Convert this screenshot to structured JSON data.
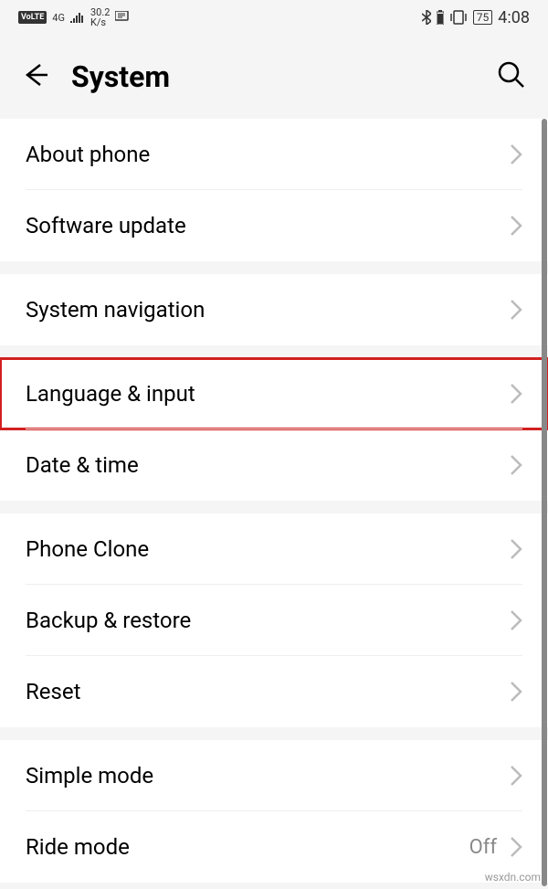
{
  "statusBar": {
    "volte": "VoLTE",
    "network": "4G",
    "speed_top": "30.2",
    "speed_bottom": "K/s",
    "battery": "75",
    "time": "4:08"
  },
  "header": {
    "title": "System"
  },
  "groups": [
    {
      "items": [
        {
          "label": "About phone",
          "highlight": false
        },
        {
          "label": "Software update",
          "highlight": false
        }
      ]
    },
    {
      "items": [
        {
          "label": "System navigation",
          "highlight": false
        }
      ]
    },
    {
      "items": [
        {
          "label": "Language & input",
          "highlight": true
        },
        {
          "label": "Date & time",
          "highlight": false
        }
      ]
    },
    {
      "items": [
        {
          "label": "Phone Clone",
          "highlight": false
        },
        {
          "label": "Backup & restore",
          "highlight": false
        },
        {
          "label": "Reset",
          "highlight": false
        }
      ]
    },
    {
      "items": [
        {
          "label": "Simple mode",
          "highlight": false
        },
        {
          "label": "Ride mode",
          "value": "Off",
          "highlight": false
        }
      ]
    }
  ],
  "watermark": "wsxdn.com"
}
